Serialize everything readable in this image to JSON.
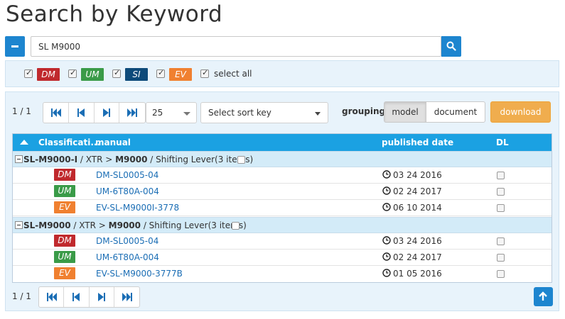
{
  "page": {
    "title": "Search by Keyword"
  },
  "search": {
    "value": "SL M9000"
  },
  "filters": {
    "items": [
      {
        "label": "DM",
        "checked": true,
        "color": "#c0292d"
      },
      {
        "label": "UM",
        "checked": true,
        "color": "#3a9b48"
      },
      {
        "label": "SI",
        "checked": true,
        "color": "#0d4a7a"
      },
      {
        "label": "EV",
        "checked": true,
        "color": "#f08030"
      }
    ],
    "select_all_label": "select all"
  },
  "toolbar": {
    "page_count": "1 / 1",
    "per_page": "25",
    "sort_placeholder": "Select sort key",
    "grouping_label": "grouping",
    "grouping_options": [
      "model",
      "document"
    ],
    "grouping_active": "model",
    "download_label": "download",
    "accent": "#1ba1e2",
    "download_color": "#f0ad4e"
  },
  "table": {
    "headers": {
      "classification": "Classificati...",
      "manual": "manual",
      "published_date": "published date",
      "dl": "DL"
    },
    "groups": [
      {
        "model": "SL-M9000-I",
        "path_mid": " / XTR > ",
        "model2": "M9000",
        "path_end": " / Shifting Lever(3 items)",
        "rows": [
          {
            "type": "DM",
            "manual": "DM-SL0005-04",
            "date": "03 24 2016"
          },
          {
            "type": "UM",
            "manual": "UM-6T80A-004",
            "date": "02 24 2017"
          },
          {
            "type": "EV",
            "manual": "EV-SL-M9000I-3778",
            "date": "06 10 2014"
          }
        ]
      },
      {
        "model": "SL-M9000",
        "path_mid": " / XTR > ",
        "model2": "M9000",
        "path_end": " / Shifting Lever(3 items)",
        "rows": [
          {
            "type": "DM",
            "manual": "DM-SL0005-04",
            "date": "03 24 2016"
          },
          {
            "type": "UM",
            "manual": "UM-6T80A-004",
            "date": "02 24 2017"
          },
          {
            "type": "EV",
            "manual": "EV-SL-M9000-3777B",
            "date": "01 05 2016"
          }
        ]
      }
    ]
  },
  "footer": {
    "page_count": "1 / 1"
  }
}
